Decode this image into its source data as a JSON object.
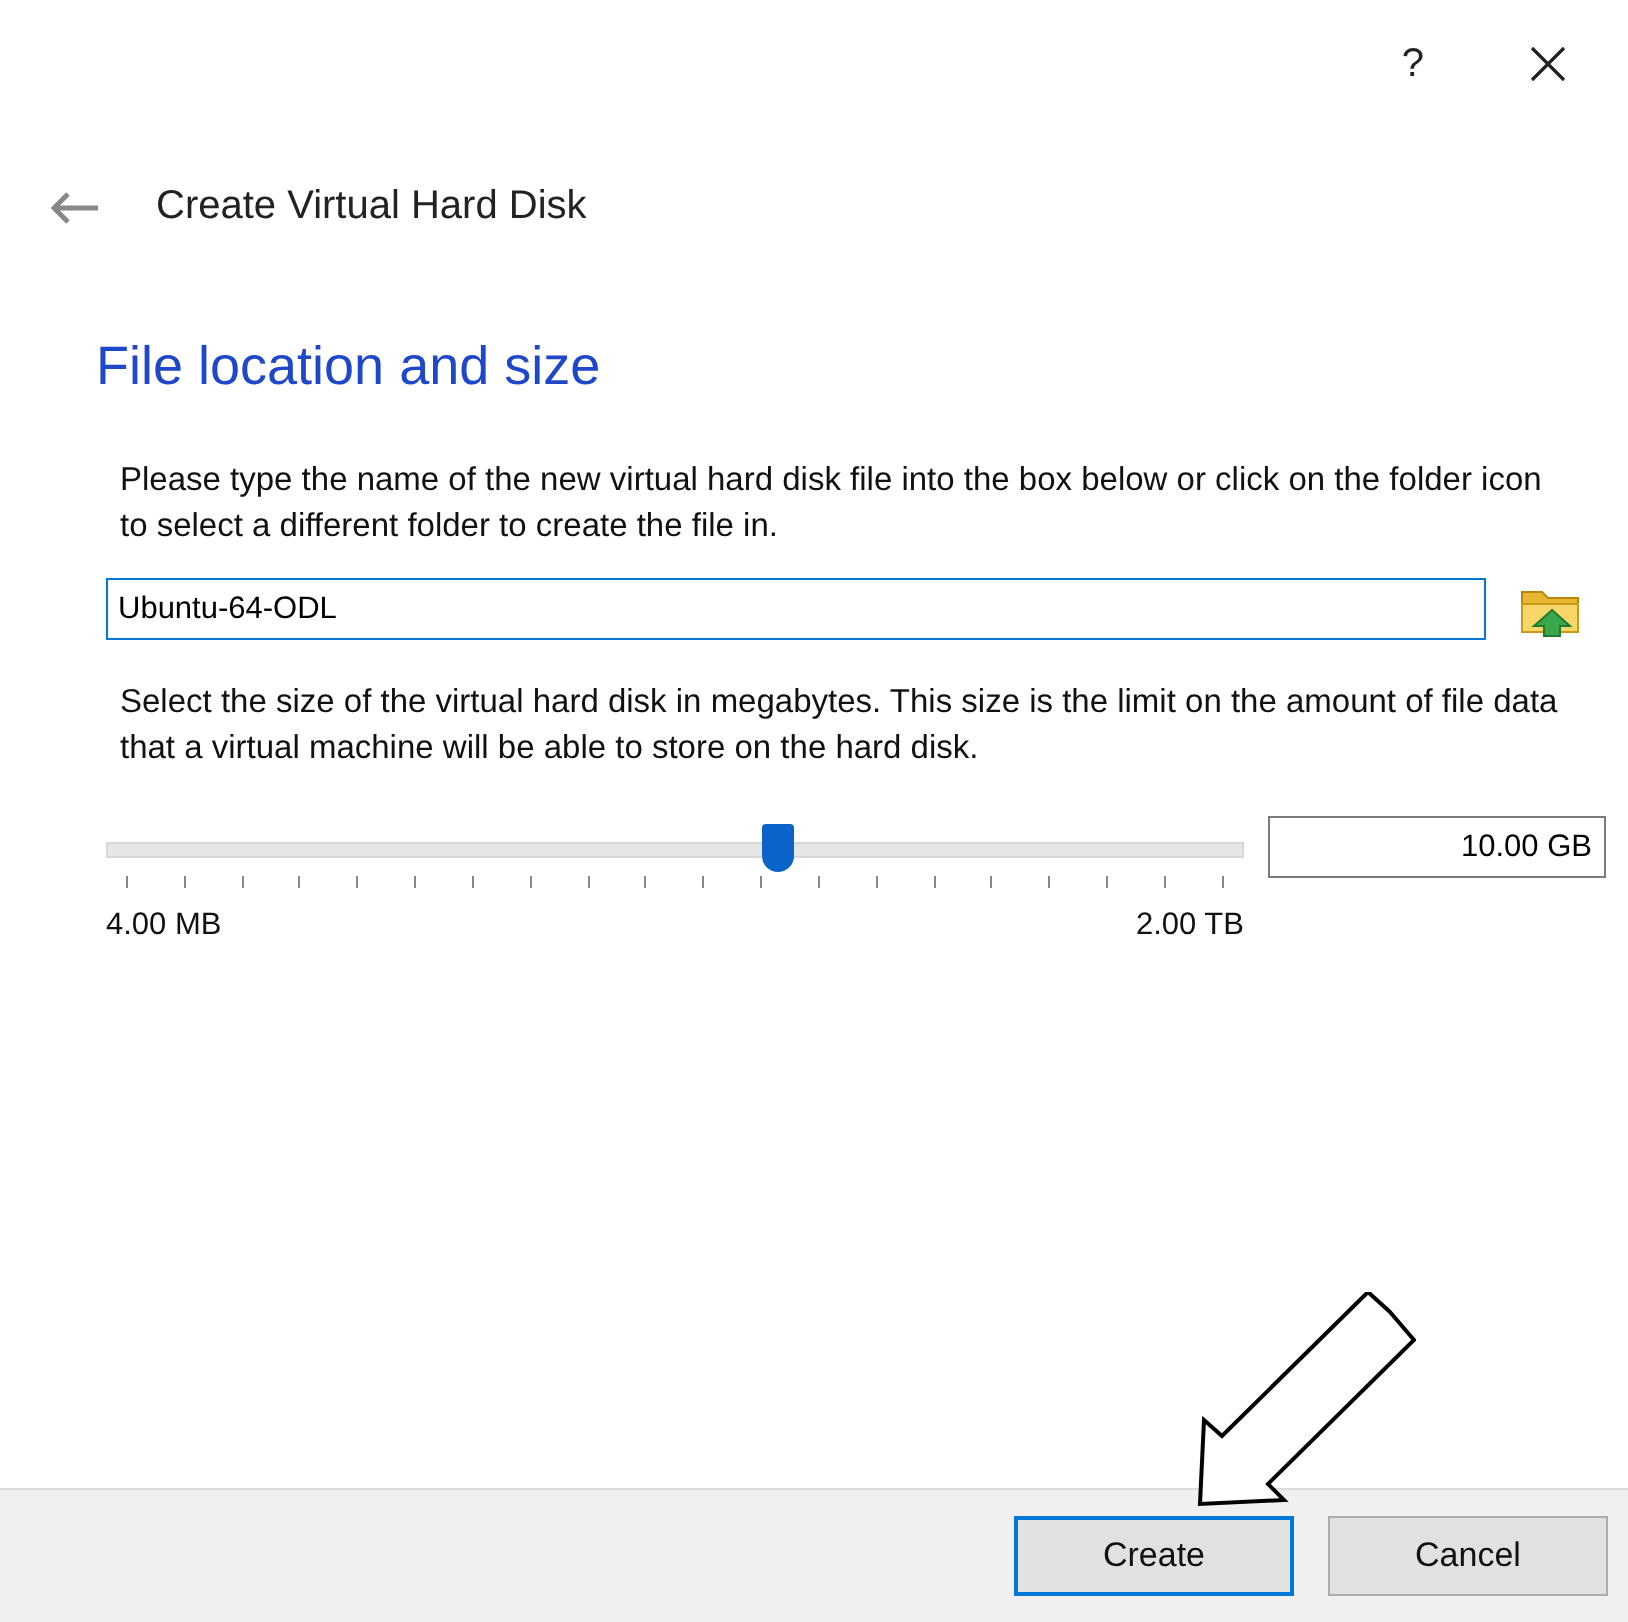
{
  "window": {
    "help_button": "?"
  },
  "wizard": {
    "title": "Create Virtual Hard Disk"
  },
  "page": {
    "heading": "File location and size",
    "location_description": "Please type the name of the new virtual hard disk file into the box below or click on the folder icon to select a different folder to create the file in.",
    "file_name": {
      "value": "Ubuntu-64-ODL",
      "focused": true
    },
    "size_description": "Select the size of the virtual hard disk in megabytes. This size is the limit on the amount of file data that a virtual machine will be able to store on the hard disk.",
    "size_slider": {
      "level": 0.59,
      "min_label": "4.00 MB",
      "max_label": "2.00 TB"
    },
    "size_value": "10.00 GB"
  },
  "buttons": [
    {
      "label": "Create",
      "default": true
    },
    {
      "label": "Cancel",
      "default": false
    }
  ]
}
